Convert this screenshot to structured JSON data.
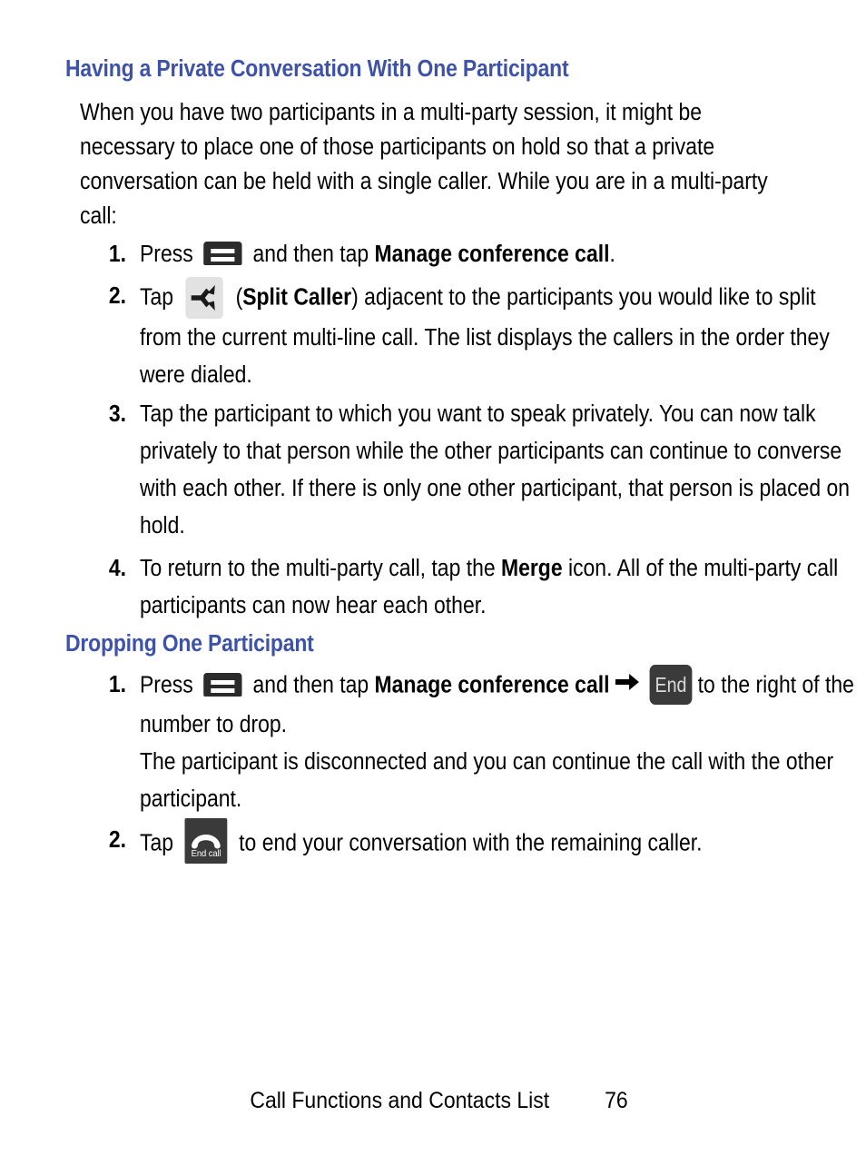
{
  "page": {
    "footer_title": "Call Functions and Contacts List",
    "page_number": "76",
    "heading_color": "#3d52a8",
    "text_color": "#000000",
    "background": "#ffffff"
  },
  "sections": [
    {
      "heading": "Having a Private Conversation With One Participant",
      "intro": "When you have two participants in a multi-party session, it might be necessary to place one of those participants on hold so that a private conversation can be held with a single caller. While you are in a multi-party call:",
      "steps": [
        {
          "number": "1.",
          "text_before_icon": "Press",
          "icon": "menu-key-icon",
          "text_after_icon": "and then tap ",
          "bold_term": "Manage conference call",
          "text_end": "."
        },
        {
          "number": "2.",
          "text_before_icon": "Tap",
          "icon": "split-caller-icon",
          "paren_open": "(",
          "bold_term": "Split Caller",
          "text_end": ") adjacent to the participants you would like to split from the current multi-line call. The list displays the callers in the order they were dialed."
        },
        {
          "number": "3.",
          "text": "Tap the participant to which you want to speak privately. You can now talk privately to that person while the other participants can continue to converse with each other. If there is only one other participant, that person is placed on hold."
        },
        {
          "number": "4.",
          "text_before_bold": "To return to the multi-party call, tap the ",
          "bold_term": "Merge",
          "text_after_bold": " icon. All of the multi-party call participants can now hear each other."
        }
      ]
    },
    {
      "heading": "Dropping One Participant",
      "steps": [
        {
          "number": "1.",
          "text_before_icon": "Press",
          "icon": "menu-key-icon",
          "text_after_icon": "and then tap ",
          "bold_term": "Manage conference call",
          "arrow": "➔",
          "end_key_label": "End",
          "text_after_key": "to the right of the number to drop.",
          "followup": "The participant is disconnected and you can continue the call with the other participant."
        },
        {
          "number": "2.",
          "text_before_icon": "Tap",
          "icon": "end-call-icon",
          "end_call_caption": "End call",
          "text_after_icon": "to end your conversation with the remaining caller."
        }
      ]
    }
  ]
}
